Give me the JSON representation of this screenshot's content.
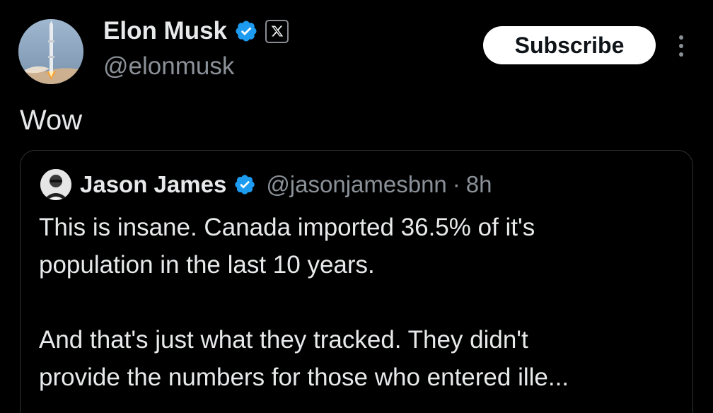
{
  "author": {
    "name": "Elon Musk",
    "handle": "@elonmusk",
    "verified": true,
    "affiliate_badge_icon": "x-logo-icon"
  },
  "actions": {
    "subscribe_label": "Subscribe",
    "more_icon": "more-vertical-icon"
  },
  "post": {
    "text": "Wow"
  },
  "quoted": {
    "name": "Jason James",
    "handle": "@jasonjamesbnn",
    "separator": "·",
    "time": "8h",
    "verified": true,
    "lines": [
      "This is insane. Canada imported 36.5% of it's",
      "population in the last 10 years.",
      "",
      "And that's just what they tracked. They didn't",
      "provide the numbers for those who entered ille..."
    ]
  },
  "colors": {
    "background": "#000000",
    "primary_text": "#e7e9ea",
    "secondary_text": "#8b9198",
    "verified_blue": "#1d9bf0",
    "border": "#2f3336",
    "button_bg": "#ffffff",
    "button_text": "#0f1419"
  }
}
